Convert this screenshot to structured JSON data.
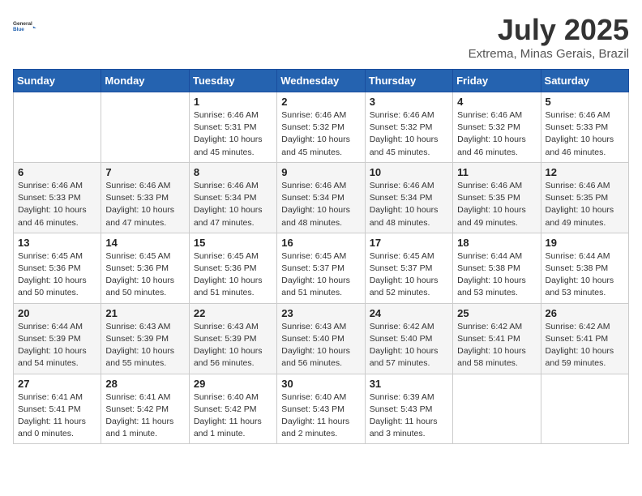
{
  "header": {
    "logo_line1": "General",
    "logo_line2": "Blue",
    "month": "July 2025",
    "location": "Extrema, Minas Gerais, Brazil"
  },
  "weekdays": [
    "Sunday",
    "Monday",
    "Tuesday",
    "Wednesday",
    "Thursday",
    "Friday",
    "Saturday"
  ],
  "weeks": [
    [
      {
        "day": "",
        "info": ""
      },
      {
        "day": "",
        "info": ""
      },
      {
        "day": "1",
        "info": "Sunrise: 6:46 AM\nSunset: 5:31 PM\nDaylight: 10 hours and 45 minutes."
      },
      {
        "day": "2",
        "info": "Sunrise: 6:46 AM\nSunset: 5:32 PM\nDaylight: 10 hours and 45 minutes."
      },
      {
        "day": "3",
        "info": "Sunrise: 6:46 AM\nSunset: 5:32 PM\nDaylight: 10 hours and 45 minutes."
      },
      {
        "day": "4",
        "info": "Sunrise: 6:46 AM\nSunset: 5:32 PM\nDaylight: 10 hours and 46 minutes."
      },
      {
        "day": "5",
        "info": "Sunrise: 6:46 AM\nSunset: 5:33 PM\nDaylight: 10 hours and 46 minutes."
      }
    ],
    [
      {
        "day": "6",
        "info": "Sunrise: 6:46 AM\nSunset: 5:33 PM\nDaylight: 10 hours and 46 minutes."
      },
      {
        "day": "7",
        "info": "Sunrise: 6:46 AM\nSunset: 5:33 PM\nDaylight: 10 hours and 47 minutes."
      },
      {
        "day": "8",
        "info": "Sunrise: 6:46 AM\nSunset: 5:34 PM\nDaylight: 10 hours and 47 minutes."
      },
      {
        "day": "9",
        "info": "Sunrise: 6:46 AM\nSunset: 5:34 PM\nDaylight: 10 hours and 48 minutes."
      },
      {
        "day": "10",
        "info": "Sunrise: 6:46 AM\nSunset: 5:34 PM\nDaylight: 10 hours and 48 minutes."
      },
      {
        "day": "11",
        "info": "Sunrise: 6:46 AM\nSunset: 5:35 PM\nDaylight: 10 hours and 49 minutes."
      },
      {
        "day": "12",
        "info": "Sunrise: 6:46 AM\nSunset: 5:35 PM\nDaylight: 10 hours and 49 minutes."
      }
    ],
    [
      {
        "day": "13",
        "info": "Sunrise: 6:45 AM\nSunset: 5:36 PM\nDaylight: 10 hours and 50 minutes."
      },
      {
        "day": "14",
        "info": "Sunrise: 6:45 AM\nSunset: 5:36 PM\nDaylight: 10 hours and 50 minutes."
      },
      {
        "day": "15",
        "info": "Sunrise: 6:45 AM\nSunset: 5:36 PM\nDaylight: 10 hours and 51 minutes."
      },
      {
        "day": "16",
        "info": "Sunrise: 6:45 AM\nSunset: 5:37 PM\nDaylight: 10 hours and 51 minutes."
      },
      {
        "day": "17",
        "info": "Sunrise: 6:45 AM\nSunset: 5:37 PM\nDaylight: 10 hours and 52 minutes."
      },
      {
        "day": "18",
        "info": "Sunrise: 6:44 AM\nSunset: 5:38 PM\nDaylight: 10 hours and 53 minutes."
      },
      {
        "day": "19",
        "info": "Sunrise: 6:44 AM\nSunset: 5:38 PM\nDaylight: 10 hours and 53 minutes."
      }
    ],
    [
      {
        "day": "20",
        "info": "Sunrise: 6:44 AM\nSunset: 5:39 PM\nDaylight: 10 hours and 54 minutes."
      },
      {
        "day": "21",
        "info": "Sunrise: 6:43 AM\nSunset: 5:39 PM\nDaylight: 10 hours and 55 minutes."
      },
      {
        "day": "22",
        "info": "Sunrise: 6:43 AM\nSunset: 5:39 PM\nDaylight: 10 hours and 56 minutes."
      },
      {
        "day": "23",
        "info": "Sunrise: 6:43 AM\nSunset: 5:40 PM\nDaylight: 10 hours and 56 minutes."
      },
      {
        "day": "24",
        "info": "Sunrise: 6:42 AM\nSunset: 5:40 PM\nDaylight: 10 hours and 57 minutes."
      },
      {
        "day": "25",
        "info": "Sunrise: 6:42 AM\nSunset: 5:41 PM\nDaylight: 10 hours and 58 minutes."
      },
      {
        "day": "26",
        "info": "Sunrise: 6:42 AM\nSunset: 5:41 PM\nDaylight: 10 hours and 59 minutes."
      }
    ],
    [
      {
        "day": "27",
        "info": "Sunrise: 6:41 AM\nSunset: 5:41 PM\nDaylight: 11 hours and 0 minutes."
      },
      {
        "day": "28",
        "info": "Sunrise: 6:41 AM\nSunset: 5:42 PM\nDaylight: 11 hours and 1 minute."
      },
      {
        "day": "29",
        "info": "Sunrise: 6:40 AM\nSunset: 5:42 PM\nDaylight: 11 hours and 1 minute."
      },
      {
        "day": "30",
        "info": "Sunrise: 6:40 AM\nSunset: 5:43 PM\nDaylight: 11 hours and 2 minutes."
      },
      {
        "day": "31",
        "info": "Sunrise: 6:39 AM\nSunset: 5:43 PM\nDaylight: 11 hours and 3 minutes."
      },
      {
        "day": "",
        "info": ""
      },
      {
        "day": "",
        "info": ""
      }
    ]
  ]
}
